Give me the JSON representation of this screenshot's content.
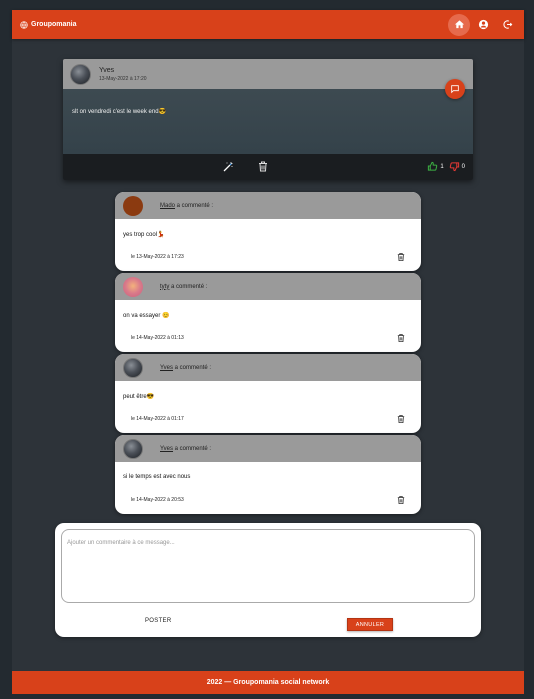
{
  "header": {
    "brand": "Groupomania",
    "nav": [
      "home-icon",
      "account-icon",
      "logout-icon"
    ]
  },
  "post": {
    "author": "Yves",
    "date": "13-May-2022 à 17:20",
    "text": "slt on vendredi c'est le week end😎",
    "likes": "1",
    "dislikes": "0"
  },
  "comments": [
    {
      "name": "Mado",
      "suffix": " a commenté :",
      "text": "yes trop cool💃",
      "date": "le 13-May-2022 à 17:23"
    },
    {
      "name": "tyty",
      "suffix": " a commenté :",
      "text": "on va essayer 😊",
      "date": "le 14-May-2022 à 01:13"
    },
    {
      "name": "Yves",
      "suffix": " a commenté :",
      "text": "peut être😎",
      "date": "le 14-May-2022 à 01:17"
    },
    {
      "name": "Yves",
      "suffix": " a commenté :",
      "text": "si le temps est avec nous",
      "date": "le 14-May-2022 à 20:53"
    }
  ],
  "form": {
    "placeholder": "Ajouter un commentaire à ce message...",
    "post_label": "POSTER",
    "cancel_label": "ANNULER"
  },
  "footer": {
    "text": "2022 — Groupomania social network"
  },
  "colors": {
    "accent": "#d8411a",
    "like": "#3cb043",
    "dislike": "#e53935"
  }
}
